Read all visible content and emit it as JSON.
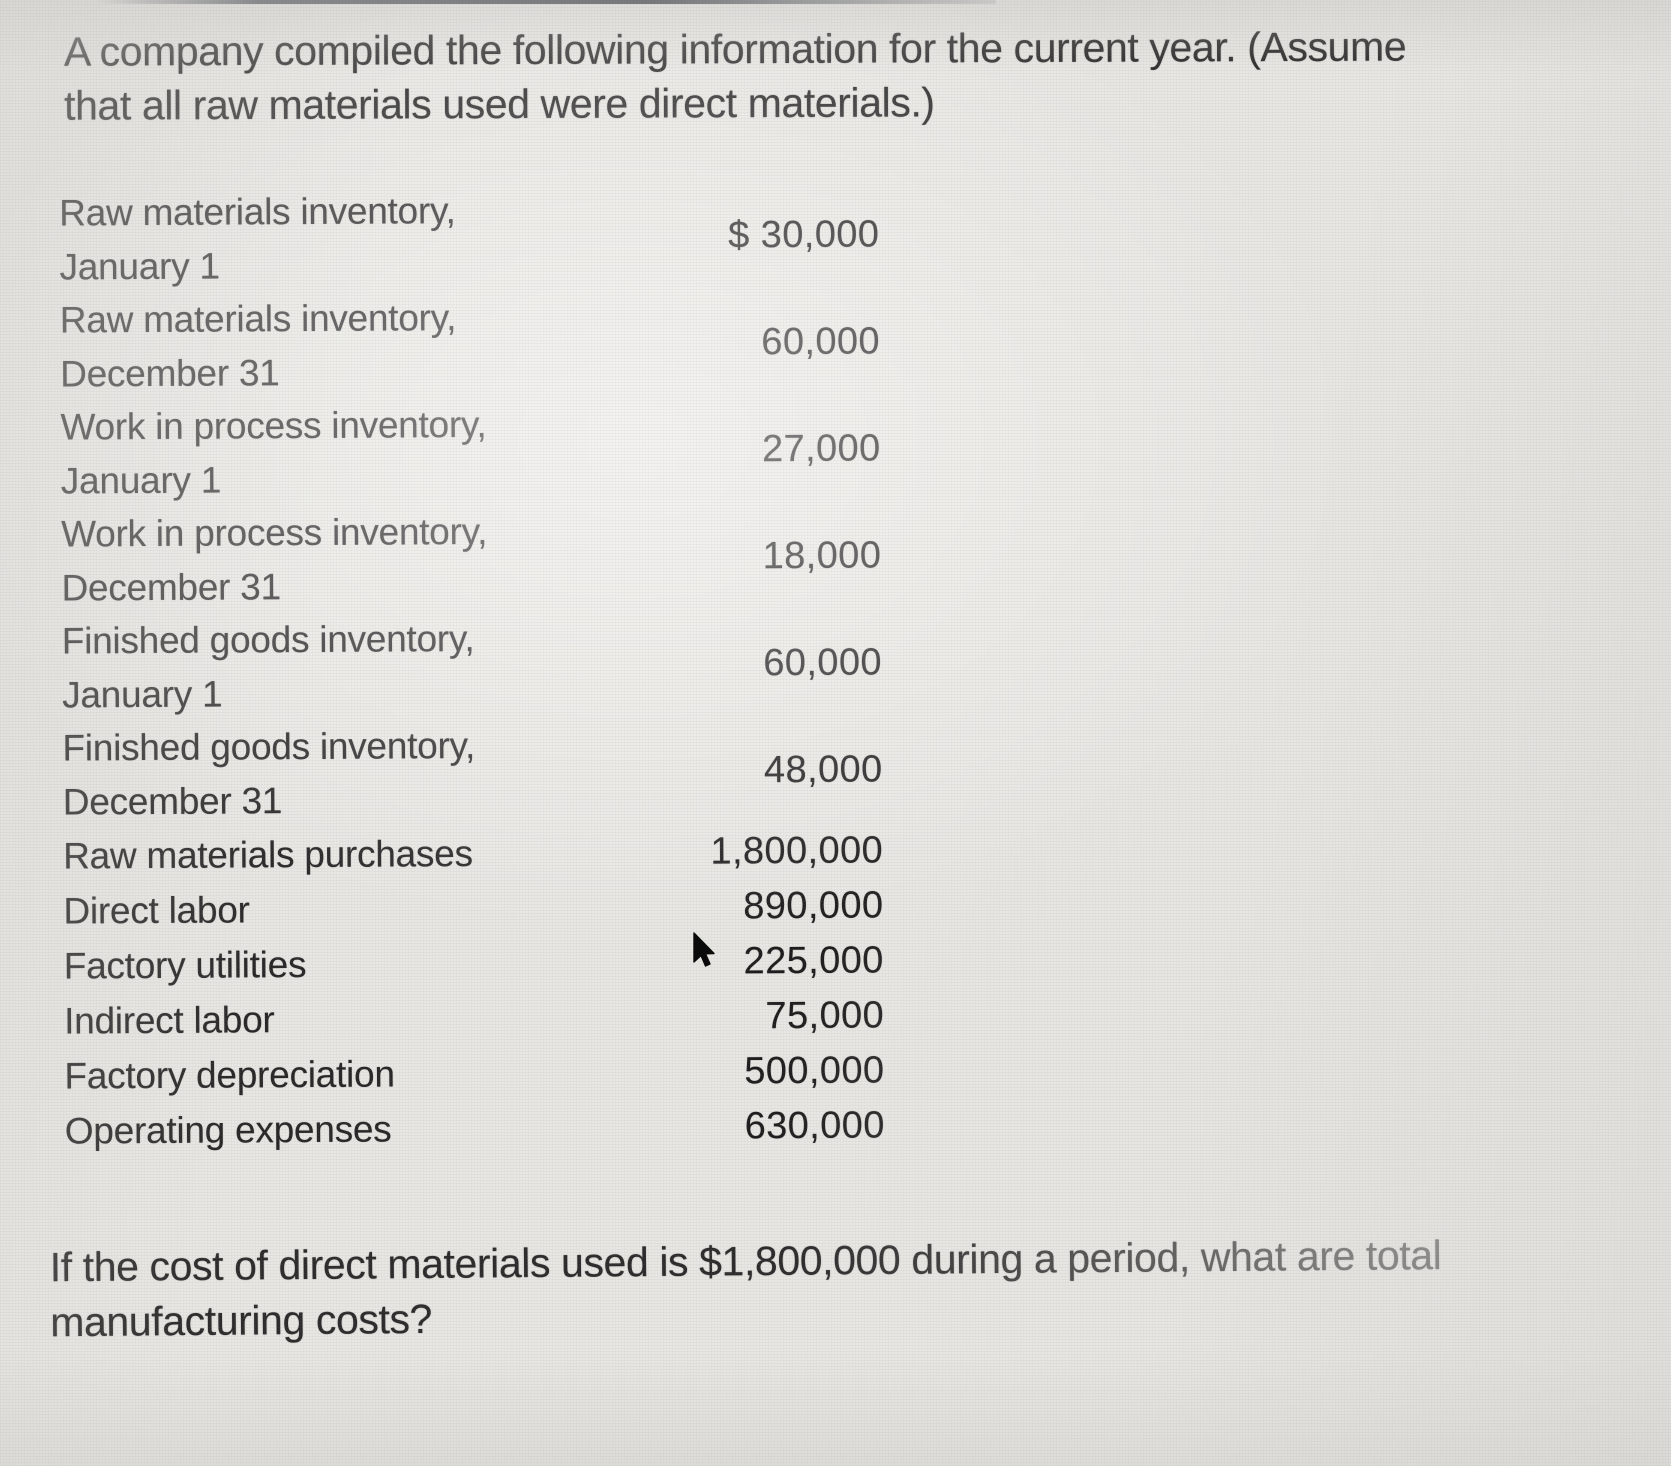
{
  "document": {
    "prompt": "A company compiled the following information for the current year. (Assume that all raw materials used were direct materials.)",
    "closing_question": "If the cost of direct materials used is $1,800,000 during a period, what are total manufacturing costs?"
  },
  "table": {
    "rows": [
      {
        "label_line1": "Raw materials inventory,",
        "label_line2": "January 1",
        "value": "$ 30,000"
      },
      {
        "label_line1": "Raw materials inventory,",
        "label_line2": "December 31",
        "value": "60,000"
      },
      {
        "label_line1": "Work in process inventory,",
        "label_line2": "January 1",
        "value": "27,000"
      },
      {
        "label_line1": "Work in process inventory,",
        "label_line2": "December 31",
        "value": "18,000"
      },
      {
        "label_line1": "Finished goods inventory,",
        "label_line2": "January 1",
        "value": "60,000"
      },
      {
        "label_line1": "Finished goods inventory,",
        "label_line2": "December 31",
        "value": "48,000"
      },
      {
        "label_line1": "Raw materials purchases",
        "label_line2": "",
        "value": "1,800,000"
      },
      {
        "label_line1": "Direct labor",
        "label_line2": "",
        "value": "890,000"
      },
      {
        "label_line1": "Factory utilities",
        "label_line2": "",
        "value": "225,000"
      },
      {
        "label_line1": "Indirect labor",
        "label_line2": "",
        "value": "75,000"
      },
      {
        "label_line1": "Factory depreciation",
        "label_line2": "",
        "value": "500,000"
      },
      {
        "label_line1": "Operating expenses",
        "label_line2": "",
        "value": "630,000"
      }
    ]
  },
  "cursor": {
    "name": "mouse-pointer"
  },
  "colors": {
    "background": "#e9e7e3",
    "text": "#272727",
    "cursor": "#0a0a0a"
  }
}
